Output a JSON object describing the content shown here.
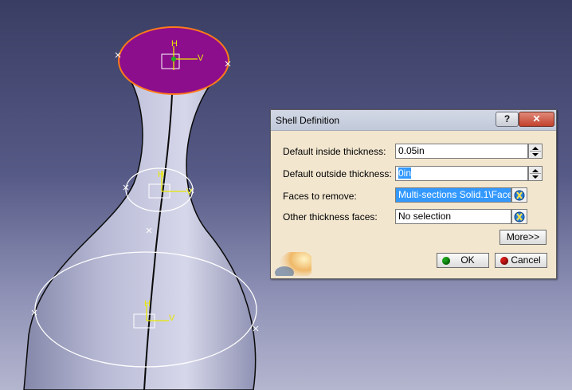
{
  "dialog": {
    "title": "Shell Definition",
    "help_label": "?",
    "close_label": "✕",
    "fields": {
      "inside_thickness": {
        "label": "Default inside thickness:",
        "value": "0.05in"
      },
      "outside_thickness": {
        "label": "Default outside thickness:",
        "value": "0in"
      },
      "faces_to_remove": {
        "label": "Faces to remove:",
        "value": "Multi-sections Solid.1\\Face"
      },
      "other_faces": {
        "label": "Other thickness faces:",
        "value": "No selection"
      }
    },
    "more_label": "More>>",
    "ok_label": "OK",
    "cancel_label": "Cancel"
  },
  "viewport": {
    "axis_h": "H",
    "axis_v": "V"
  },
  "colors": {
    "face_selected": "#8c0e8c",
    "highlight": "#3399ff",
    "ok_dot": "#1aa31a",
    "cancel_dot": "#d41a1a"
  }
}
